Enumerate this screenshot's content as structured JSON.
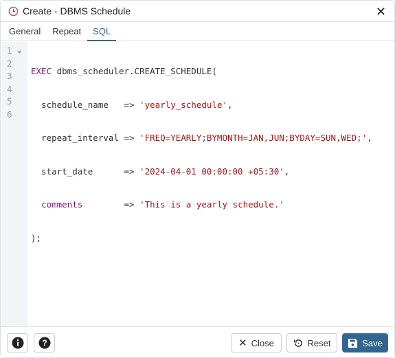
{
  "window": {
    "title": "Create - DBMS Schedule"
  },
  "tabs": [
    {
      "label": "General"
    },
    {
      "label": "Repeat"
    },
    {
      "label": "SQL",
      "active": true
    }
  ],
  "editor": {
    "line_numbers": [
      "1",
      "2",
      "3",
      "4",
      "5",
      "6"
    ],
    "lines": [
      {
        "kw": "EXEC",
        "rest": " dbms_scheduler.CREATE_SCHEDULE("
      },
      {
        "pre": "  schedule_name   => ",
        "str": "'yearly_schedule'",
        "post": ","
      },
      {
        "pre": "  repeat_interval => ",
        "str": "'FREQ=YEARLY;BYMONTH=JAN,JUN;BYDAY=SUN,WED;'",
        "post": ","
      },
      {
        "pre": "  start_date      => ",
        "str": "'2024-04-01 00:00:00 +05:30'",
        "post": ","
      },
      {
        "kw": "comments",
        "pre": "  ",
        "mid": "        => ",
        "str": "'This is a yearly schedule.'"
      },
      {
        "pre": ");"
      }
    ]
  },
  "footer": {
    "close_label": "Close",
    "reset_label": "Reset",
    "save_label": "Save"
  },
  "colors": {
    "accent": "#326690",
    "keyword": "#7a1a7a",
    "string": "#a31515"
  }
}
